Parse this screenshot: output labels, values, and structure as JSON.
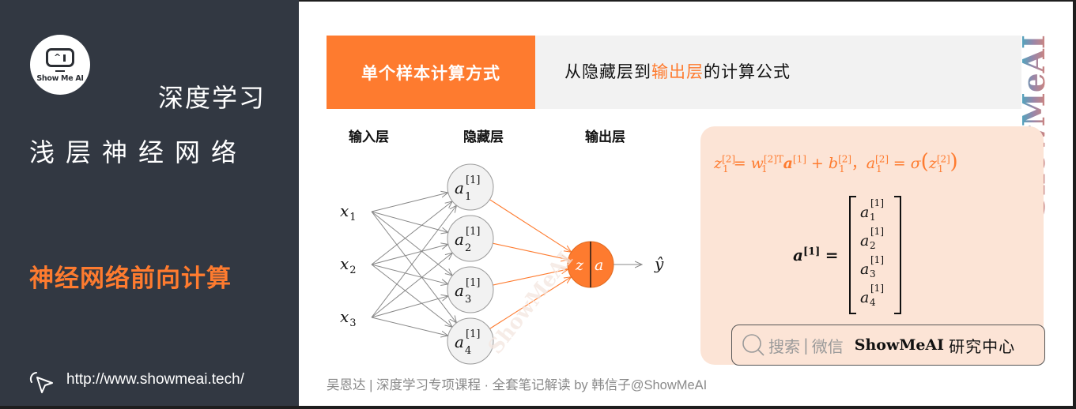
{
  "left_panel": {
    "logo_text": "Show Me AI",
    "logo_face": "^",
    "course_title": "深度学习",
    "chapter_title": "浅层神经网络",
    "topic_title": "神经网络前向计算",
    "site_url": "http://www.showmeai.tech/",
    "cursor_icon": "cursor-click-icon"
  },
  "header": {
    "tag": "单个样本计算方式",
    "desc_before": "从隐藏层到",
    "desc_highlight": "输出层",
    "desc_after": "的计算公式"
  },
  "diagram": {
    "layer_labels": [
      "输入层",
      "隐藏层",
      "输出层"
    ],
    "inputs": [
      {
        "base": "x",
        "sub": "1"
      },
      {
        "base": "x",
        "sub": "2"
      },
      {
        "base": "x",
        "sub": "3"
      }
    ],
    "hidden": [
      {
        "base": "a",
        "sup": "[1]",
        "sub": "1"
      },
      {
        "base": "a",
        "sup": "[1]",
        "sub": "2"
      },
      {
        "base": "a",
        "sup": "[1]",
        "sub": "3"
      },
      {
        "base": "a",
        "sup": "[1]",
        "sub": "4"
      }
    ],
    "output_left": "z",
    "output_right": "a",
    "prediction": "ŷ",
    "watermark": "ShowMeAI"
  },
  "formula": {
    "z_lhs": "z",
    "z_lhs_sup": "[2]",
    "z_lhs_sub": "1",
    "eq": " = ",
    "w": "w",
    "w_sup": "[2]T",
    "w_sub": "1",
    "a_vec": "a",
    "a_vec_sup": "[1]",
    "plus": " + ",
    "b": "b",
    "b_sup": "[2]",
    "b_sub": "1",
    "comma": "，",
    "a_lhs": "a",
    "a_lhs_sup": "[2]",
    "a_lhs_sub": "1",
    "eq2": " = ",
    "sigma": "σ",
    "lparen": "(",
    "z_arg": "z",
    "z_arg_sup": "[2]",
    "z_arg_sub": "1",
    "rparen": ")"
  },
  "vector": {
    "lhs": "a",
    "lhs_sup": "[1]",
    "eq": "=",
    "entries": [
      {
        "base": "a",
        "sup": "[1]",
        "sub": "1"
      },
      {
        "base": "a",
        "sup": "[1]",
        "sub": "2"
      },
      {
        "base": "a",
        "sup": "[1]",
        "sub": "3"
      },
      {
        "base": "a",
        "sup": "[1]",
        "sub": "4"
      }
    ]
  },
  "search_box": {
    "label": "搜索",
    "separator": "|",
    "channel": "微信",
    "brand": "ShowMeAI",
    "brand_cn": "研究中心"
  },
  "vertical_watermark": "ShowMeAI",
  "footer": {
    "credit": "吴恩达 | 深度学习专项课程 · 全套笔记解读  by 韩信子@ShowMeAI"
  },
  "colors": {
    "accent": "#fe7b2f",
    "dark_panel": "#323842",
    "formula_bg": "#fce4d6",
    "header_gray": "#f2f2f2",
    "node_fill": "#f2f2f2",
    "edge_gray": "#888888"
  }
}
